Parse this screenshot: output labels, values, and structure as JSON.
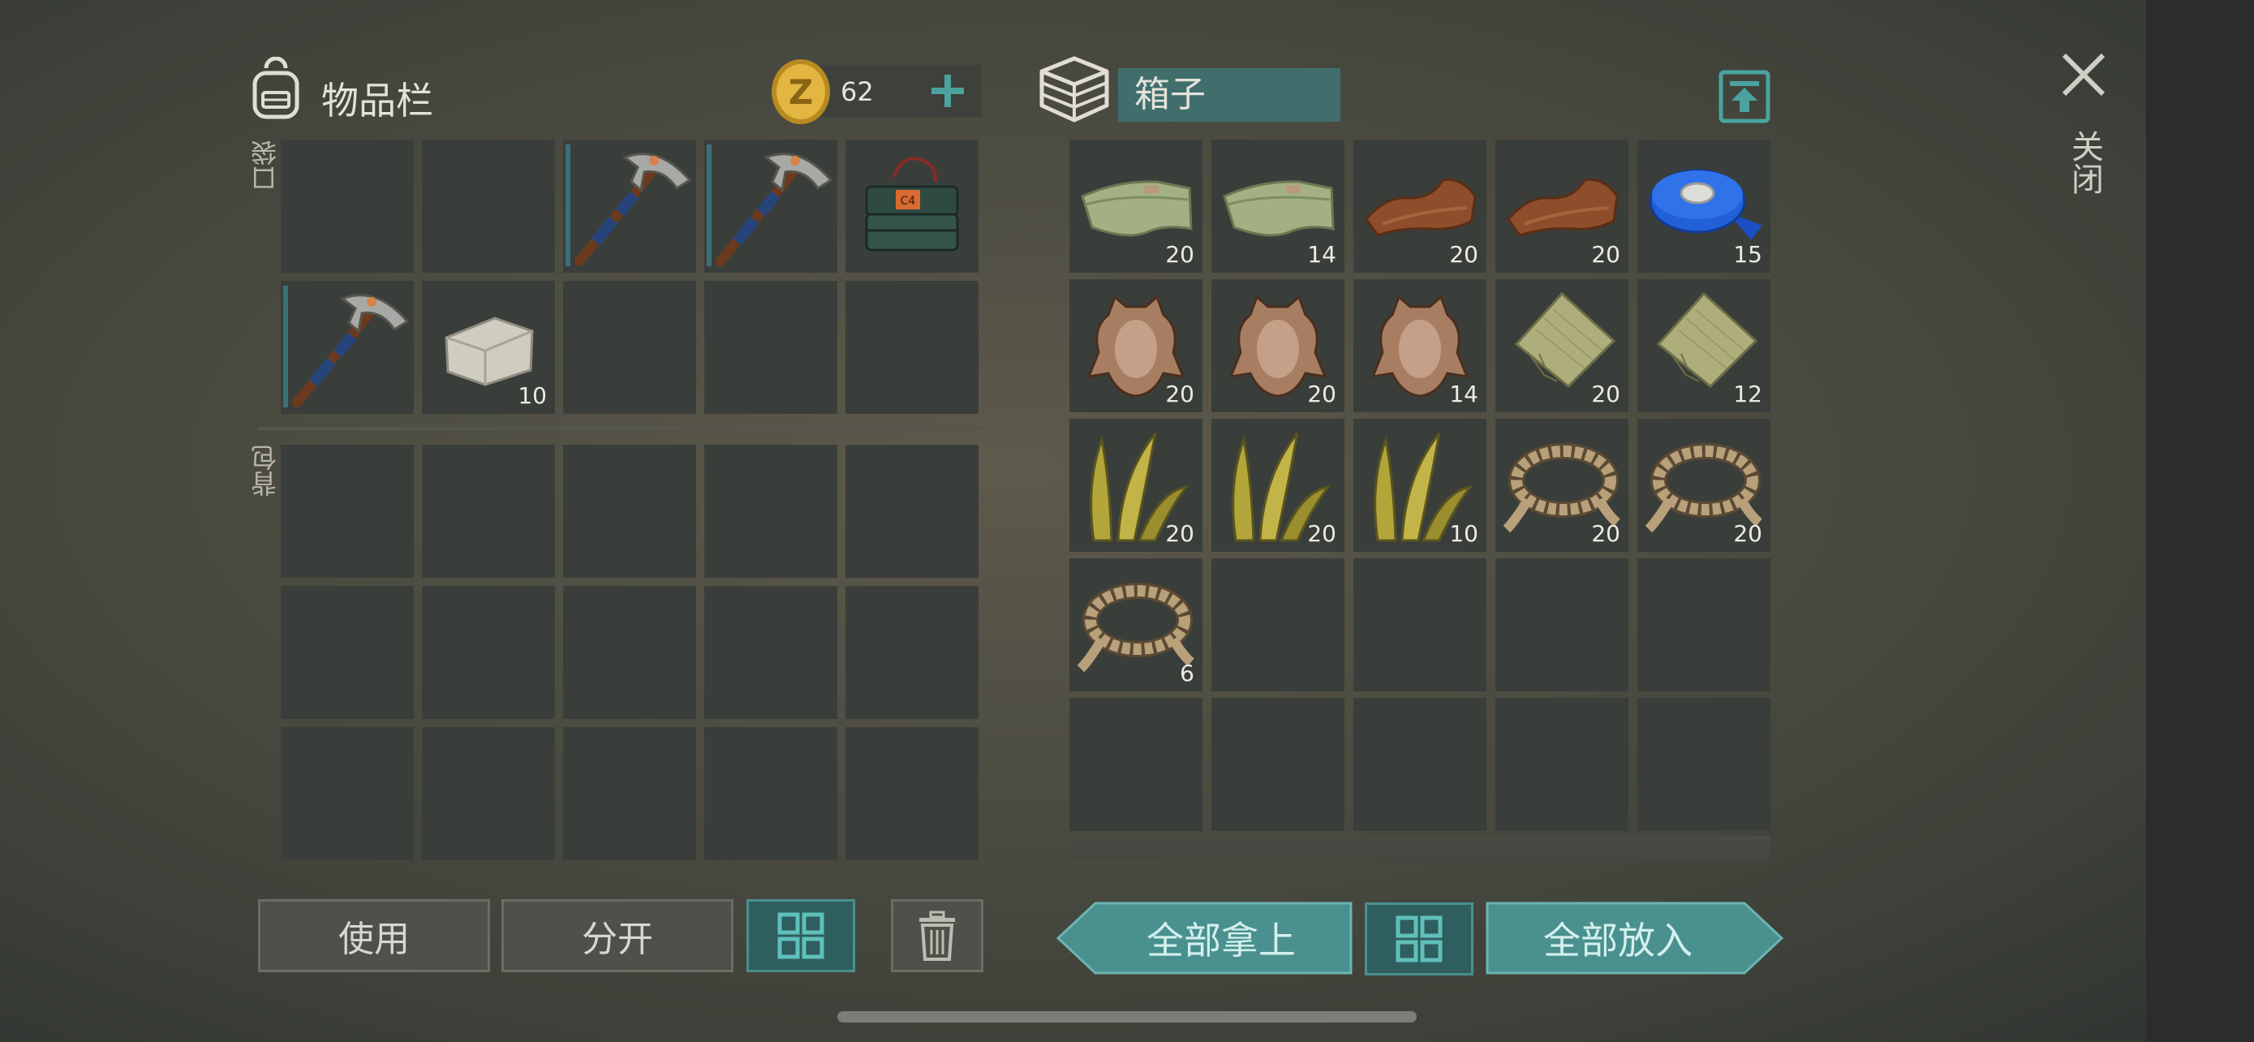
{
  "inventory": {
    "title": "物品栏",
    "coins": "62",
    "pockets_label": "口袋",
    "backpack_label": "背包",
    "pockets": [
      {
        "item": "",
        "count": ""
      },
      {
        "item": "",
        "count": ""
      },
      {
        "item": "pickaxe-icon",
        "count": ""
      },
      {
        "item": "pickaxe-icon",
        "count": ""
      },
      {
        "item": "c4-explosive-icon",
        "count": "",
        "label": "C4"
      },
      {
        "item": "pickaxe-icon",
        "count": ""
      },
      {
        "item": "stone-icon",
        "count": "10"
      },
      {
        "item": "",
        "count": ""
      },
      {
        "item": "",
        "count": ""
      },
      {
        "item": "",
        "count": ""
      }
    ],
    "buttons": {
      "use": "使用",
      "split": "分开"
    }
  },
  "chest": {
    "title": "箱子",
    "slots": [
      {
        "item": "cloth-icon",
        "count": "20"
      },
      {
        "item": "cloth-icon",
        "count": "14"
      },
      {
        "item": "leather-icon",
        "count": "20"
      },
      {
        "item": "leather-icon",
        "count": "20"
      },
      {
        "item": "tape-icon",
        "count": "15"
      },
      {
        "item": "hide-icon",
        "count": "20"
      },
      {
        "item": "hide-icon",
        "count": "20"
      },
      {
        "item": "hide-icon",
        "count": "14"
      },
      {
        "item": "burlap-icon",
        "count": "20"
      },
      {
        "item": "burlap-icon",
        "count": "12"
      },
      {
        "item": "fiber-icon",
        "count": "20"
      },
      {
        "item": "fiber-icon",
        "count": "20"
      },
      {
        "item": "fiber-icon",
        "count": "10"
      },
      {
        "item": "rope-icon",
        "count": "20"
      },
      {
        "item": "rope-icon",
        "count": "20"
      },
      {
        "item": "rope-icon",
        "count": "6"
      }
    ],
    "buttons": {
      "take_all": "全部拿上",
      "put_all": "全部放入"
    }
  },
  "close_label": "关闭",
  "colors": {
    "accent": "#49908f",
    "slot": "#3a3e3a",
    "coin": "#d9a93a"
  }
}
